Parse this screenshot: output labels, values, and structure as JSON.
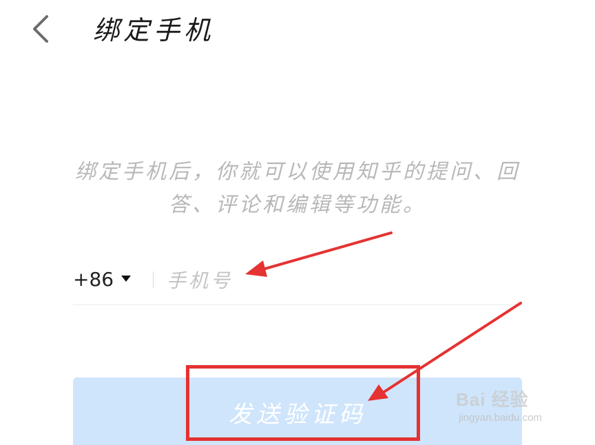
{
  "header": {
    "back_icon": "chevron-left-icon",
    "title": "绑定手机"
  },
  "main": {
    "description": "绑定手机后，你就可以使用知乎的提问、回答、评论和编辑等功能。",
    "phone": {
      "country_code": "+86",
      "caret_icon": "caret-down-icon",
      "placeholder": "手机号",
      "value": ""
    },
    "send_button": {
      "label": "发送验证码"
    }
  },
  "colors": {
    "title_text": "#1a1a1a",
    "description_text": "#b8b8b8",
    "button_bg": "#cfe5fb",
    "button_text": "#ffffff",
    "annotation_red": "#e53232"
  },
  "watermark": {
    "logo": "Bai 经验",
    "url": "jingyan.baidu.com"
  }
}
